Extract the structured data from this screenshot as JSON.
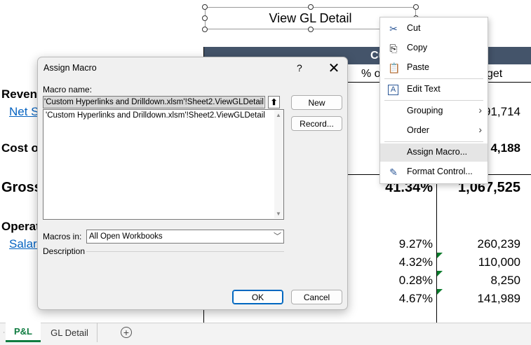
{
  "shape_button": {
    "label": "View GL Detail"
  },
  "sheet": {
    "header_partial": "Cu",
    "col1_header_partial": "% of",
    "col2_header_partial": "get",
    "rows": {
      "revenue": "Revenu",
      "net_sales": "Net S",
      "net_sales_budget": "91,714",
      "cost_of": "Cost of",
      "cost_budget": "4,188",
      "gross": "Gross",
      "gross_pct": "41.34%",
      "gross_budget": "1,067,525",
      "operating": "Operat",
      "salaries": "Salari",
      "lines": [
        {
          "pct": "9.27%",
          "budget": "260,239"
        },
        {
          "pct": "4.32%",
          "budget": "110,000"
        },
        {
          "pct": "0.28%",
          "budget": "8,250"
        },
        {
          "pct": "4.67%",
          "budget": "141,989"
        }
      ]
    }
  },
  "tabs": {
    "active": "P&L",
    "other": "GL Detail",
    "add_icon": "+"
  },
  "dialog": {
    "title": "Assign Macro",
    "help": "?",
    "close": "✕",
    "macro_name_label": "Macro name:",
    "macro_name_value": "'Custom Hyperlinks and Drilldown.xlsm'!Sheet2.ViewGLDetail",
    "list_items": [
      "'Custom Hyperlinks and Drilldown.xlsm'!Sheet2.ViewGLDetail"
    ],
    "new_button": "New",
    "record_button": "Record...",
    "macros_in_label": "Macros in:",
    "macros_in_value": "All Open Workbooks",
    "description_label": "Description",
    "ok_button": "OK",
    "cancel_button": "Cancel"
  },
  "context_menu": {
    "cut": "Cut",
    "copy": "Copy",
    "paste": "Paste",
    "edit_text": "Edit Text",
    "grouping": "Grouping",
    "order": "Order",
    "assign_macro": "Assign Macro...",
    "format_control": "Format Control..."
  },
  "colors": {
    "header_band": "#44546a",
    "link": "#0563c1",
    "tab_active": "#107c41",
    "ok_border": "#0067c0"
  }
}
